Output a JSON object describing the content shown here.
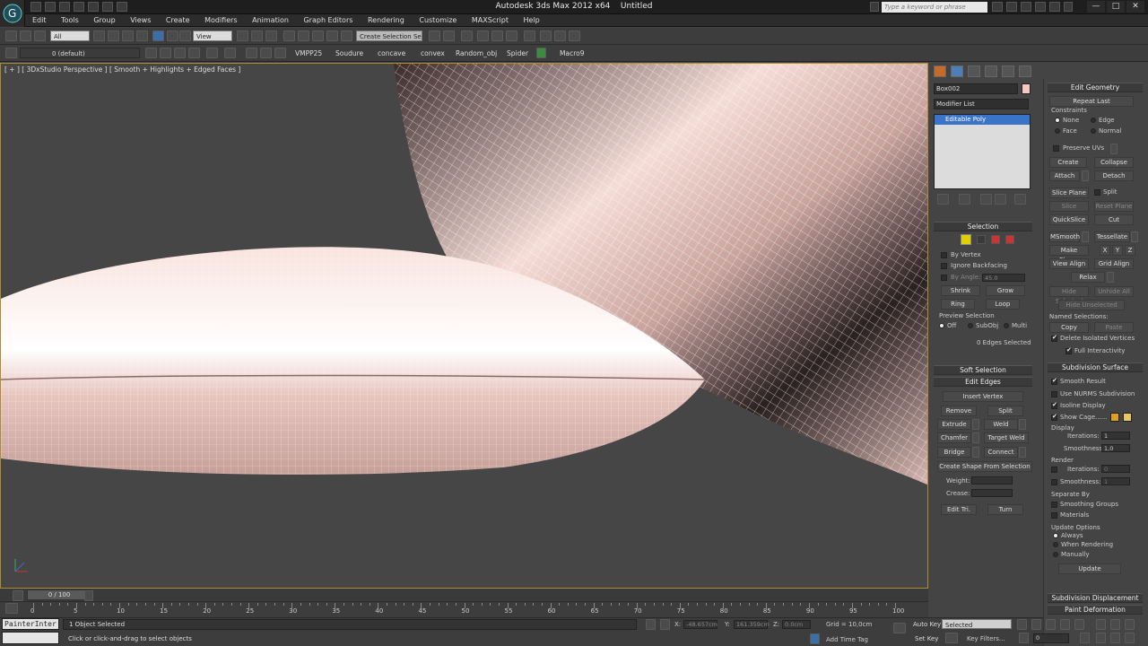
{
  "window": {
    "title": "Autodesk 3ds Max 2012 x64",
    "document": "Untitled",
    "search_placeholder": "Type a keyword or phrase",
    "min": "—",
    "max": "□",
    "close": "✕"
  },
  "menu": [
    "Edit",
    "Tools",
    "Group",
    "Views",
    "Create",
    "Modifiers",
    "Animation",
    "Graph Editors",
    "Rendering",
    "Customize",
    "MAXScript",
    "Help"
  ],
  "toolbar1": {
    "selection_filter": "All",
    "ref_coord": "View",
    "named_selection": "Create Selection Se"
  },
  "toolbar2": {
    "layer": "0 (default)",
    "scripts": [
      "VMPP25",
      "Soudure",
      "concave",
      "convex",
      "Random_obj",
      "Spider",
      "Macro9"
    ]
  },
  "viewport": {
    "label": "[ + ] [ 3DxStudio Perspective ] [ Smooth + Highlights + Edged Faces ]",
    "colors": {
      "border": "#b08a2e",
      "pillow": "#f2d6d1"
    }
  },
  "command_panel": {
    "object_name": "Box002",
    "object_color": "#f5c8c2",
    "modifier_list": "Modifier List",
    "stack_item": "Editable Poly",
    "selection": {
      "title": "Selection",
      "by_vertex": "By Vertex",
      "ignore_backfacing": "Ignore Backfacing",
      "by_angle": "By Angle:",
      "by_angle_value": "45.0",
      "shrink": "Shrink",
      "grow": "Grow",
      "ring": "Ring",
      "loop": "Loop",
      "preview": "Preview Selection",
      "off": "Off",
      "subobj": "SubObj",
      "multi": "Multi",
      "status": "0 Edges Selected"
    },
    "soft_selection": "Soft Selection",
    "edit_edges": {
      "title": "Edit Edges",
      "insert_vertex": "Insert Vertex",
      "remove": "Remove",
      "split": "Split",
      "extrude": "Extrude",
      "weld": "Weld",
      "chamfer": "Chamfer",
      "target_weld": "Target Weld",
      "bridge": "Bridge",
      "connect": "Connect",
      "create_shape": "Create Shape From Selection",
      "weight": "Weight:",
      "crease": "Crease:",
      "edit_tri": "Edit Tri.",
      "turn": "Turn"
    }
  },
  "edit_geometry": {
    "title": "Edit Geometry",
    "repeat_last": "Repeat Last",
    "constraints": "Constraints",
    "none": "None",
    "edge": "Edge",
    "face": "Face",
    "normal": "Normal",
    "preserve_uvs": "Preserve UVs",
    "create": "Create",
    "collapse": "Collapse",
    "attach": "Attach",
    "detach": "Detach",
    "slice_plane": "Slice Plane",
    "split": "Split",
    "slice": "Slice",
    "reset_plane": "Reset Plane",
    "quickslice": "QuickSlice",
    "cut": "Cut",
    "msmooth": "MSmooth",
    "tessellate": "Tessellate",
    "make_planar": "Make Planar",
    "x": "X",
    "y": "Y",
    "z": "Z",
    "view_align": "View Align",
    "grid_align": "Grid Align",
    "relax": "Relax",
    "hide_selected": "Hide Selected",
    "unhide_all": "Unhide All",
    "hide_unselected": "Hide Unselected",
    "named_selections": "Named Selections:",
    "copy": "Copy",
    "paste": "Paste",
    "delete_isolated": "Delete Isolated Vertices",
    "full_interactivity": "Full Interactivity"
  },
  "subdivision": {
    "title": "Subdivision Surface",
    "smooth_result": "Smooth Result",
    "use_nurms": "Use NURMS Subdivision",
    "isoline": "Isoline Display",
    "show_cage": "Show Cage......",
    "display": "Display",
    "iterations": "Iterations:",
    "iterations_val": "1",
    "smoothness": "Smoothness:",
    "smoothness_val": "1,0",
    "render": "Render",
    "r_iterations_val": "0",
    "r_smoothness_val": "1",
    "separate_by": "Separate By",
    "smoothing_groups": "Smoothing Groups",
    "materials": "Materials",
    "update_options": "Update Options",
    "always": "Always",
    "when_rendering": "When Rendering",
    "manually": "Manually",
    "update": "Update",
    "displacement": "Subdivision Displacement",
    "paint_deformation": "Paint Deformation"
  },
  "timeline": {
    "slider": "0 / 100",
    "ticks": [
      "0",
      "5",
      "10",
      "15",
      "20",
      "25",
      "30",
      "35",
      "40",
      "45",
      "50",
      "55",
      "60",
      "65",
      "70",
      "75",
      "80",
      "85",
      "90",
      "95",
      "100"
    ]
  },
  "status": {
    "script_box": "PainterInter",
    "selected": "1 Object Selected",
    "prompt": "Click or click-and-drag to select objects",
    "x_label": "X:",
    "x_val": "-48.657cm",
    "y_label": "Y:",
    "y_val": "161.359cm",
    "z_label": "Z:",
    "z_val": "0.0cm",
    "grid": "Grid = 10,0cm",
    "add_time_tag": "Add Time Tag",
    "auto_key": "Auto Key",
    "set_key": "Set Key",
    "key_mode": "Selected",
    "key_filters": "Key Filters...",
    "frame": "0"
  }
}
